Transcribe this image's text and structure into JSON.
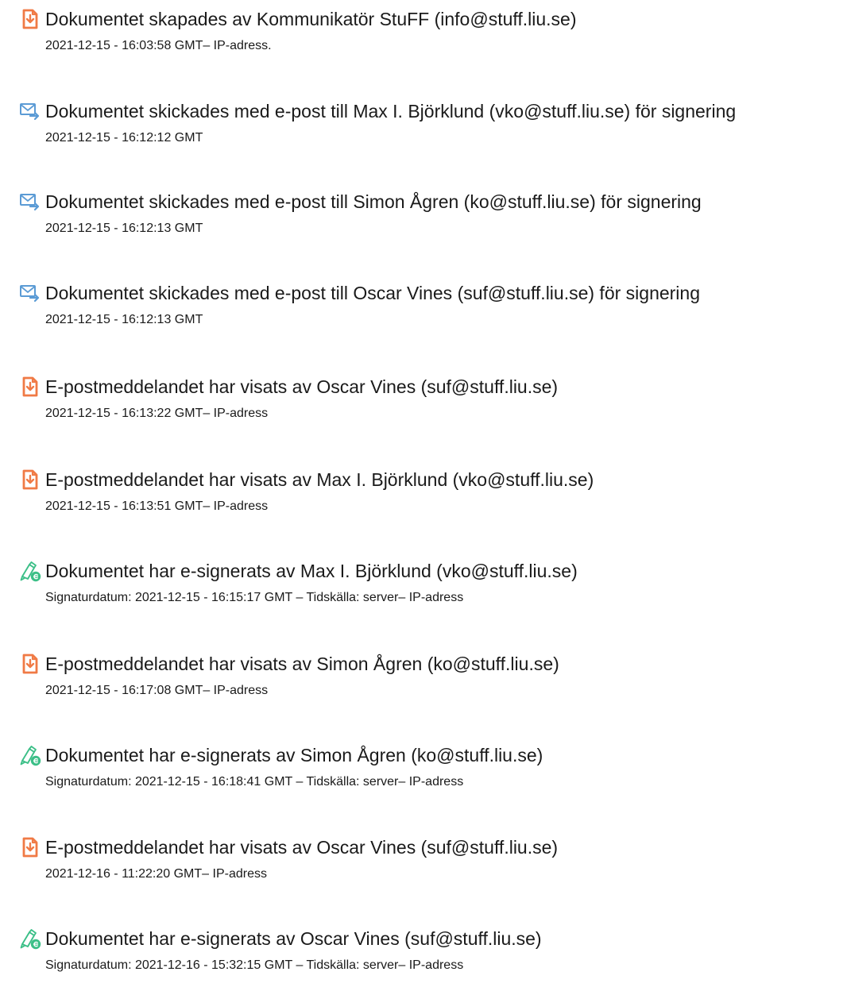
{
  "events": [
    {
      "icon": "document-icon",
      "title": "Dokumentet skapades av Kommunikatör StuFF (info@stuff.liu.se)",
      "meta": "2021-12-15 - 16:03:58 GMT– IP-adress."
    },
    {
      "icon": "email-sent-icon",
      "title": "Dokumentet skickades med e-post till Max I. Björklund (vko@stuff.liu.se) för signering",
      "meta": "2021-12-15 - 16:12:12 GMT"
    },
    {
      "icon": "email-sent-icon",
      "title": "Dokumentet skickades med e-post till Simon Ågren (ko@stuff.liu.se) för signering",
      "meta": "2021-12-15 - 16:12:13 GMT"
    },
    {
      "icon": "email-sent-icon",
      "title": "Dokumentet skickades med e-post till Oscar Vines (suf@stuff.liu.se) för signering",
      "meta": "2021-12-15 - 16:12:13 GMT"
    },
    {
      "icon": "document-icon",
      "title": "E-postmeddelandet har visats av Oscar Vines (suf@stuff.liu.se)",
      "meta": "2021-12-15 - 16:13:22 GMT– IP-adress"
    },
    {
      "icon": "document-icon",
      "title": "E-postmeddelandet har visats av Max I. Björklund (vko@stuff.liu.se)",
      "meta": "2021-12-15 - 16:13:51 GMT– IP-adress"
    },
    {
      "icon": "e-signature-icon",
      "title": "Dokumentet har e-signerats av Max I. Björklund (vko@stuff.liu.se)",
      "meta": "Signaturdatum: 2021-12-15 - 16:15:17 GMT – Tidskälla: server– IP-adress"
    },
    {
      "icon": "document-icon",
      "title": "E-postmeddelandet har visats av Simon Ågren (ko@stuff.liu.se)",
      "meta": "2021-12-15 - 16:17:08 GMT– IP-adress"
    },
    {
      "icon": "e-signature-icon",
      "title": "Dokumentet har e-signerats av Simon Ågren (ko@stuff.liu.se)",
      "meta": "Signaturdatum: 2021-12-15 - 16:18:41 GMT – Tidskälla: server– IP-adress"
    },
    {
      "icon": "document-icon",
      "title": "E-postmeddelandet har visats av Oscar Vines (suf@stuff.liu.se)",
      "meta": "2021-12-16 - 11:22:20 GMT– IP-adress"
    },
    {
      "icon": "e-signature-icon",
      "title": "Dokumentet har e-signerats av Oscar Vines (suf@stuff.liu.se)",
      "meta": "Signaturdatum: 2021-12-16 - 15:32:15 GMT – Tidskälla: server– IP-adress"
    }
  ],
  "colors": {
    "document_icon": "#f07a45",
    "email_icon": "#5b9bd5",
    "signature_icon": "#3bbf87"
  }
}
